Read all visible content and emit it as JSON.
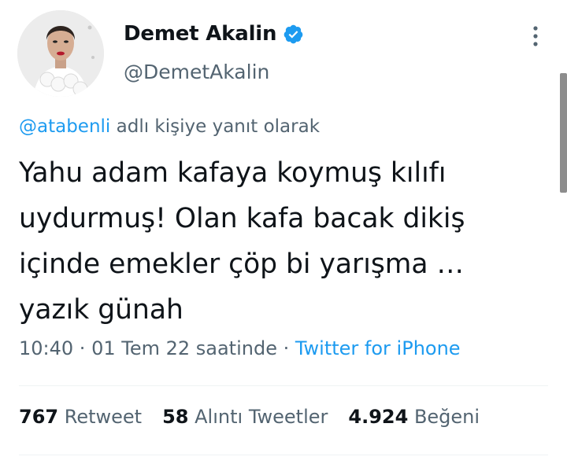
{
  "author": {
    "display_name": "Demet Akalin",
    "handle": "@DemetAkalin",
    "verified": true
  },
  "reply_context": {
    "mention": "@atabenli",
    "suffix": " adlı kişiye yanıt olarak"
  },
  "tweet": {
    "lines": [
      "Yahu adam kafaya koymuş kılıfı",
      "uydurmuş! Olan kafa bacak dikiş",
      "içinde emekler çöp bi yarışma …",
      "yazık günah"
    ]
  },
  "meta": {
    "time": "10:40",
    "separator": " · ",
    "date": "01 Tem 22 saatinde",
    "source": "Twitter for iPhone"
  },
  "stats": {
    "retweets": {
      "count": "767",
      "label": "Retweet"
    },
    "quotes": {
      "count": "58",
      "label": "Alıntı Tweetler"
    },
    "likes": {
      "count": "4.924",
      "label": "Beğeni"
    }
  },
  "icons": {
    "verified": "verified-badge-icon",
    "more": "more-vertical-icon"
  },
  "colors": {
    "link": "#1d9bf0",
    "muted": "#536471",
    "text": "#0f1419",
    "divider": "#eff3f4"
  }
}
